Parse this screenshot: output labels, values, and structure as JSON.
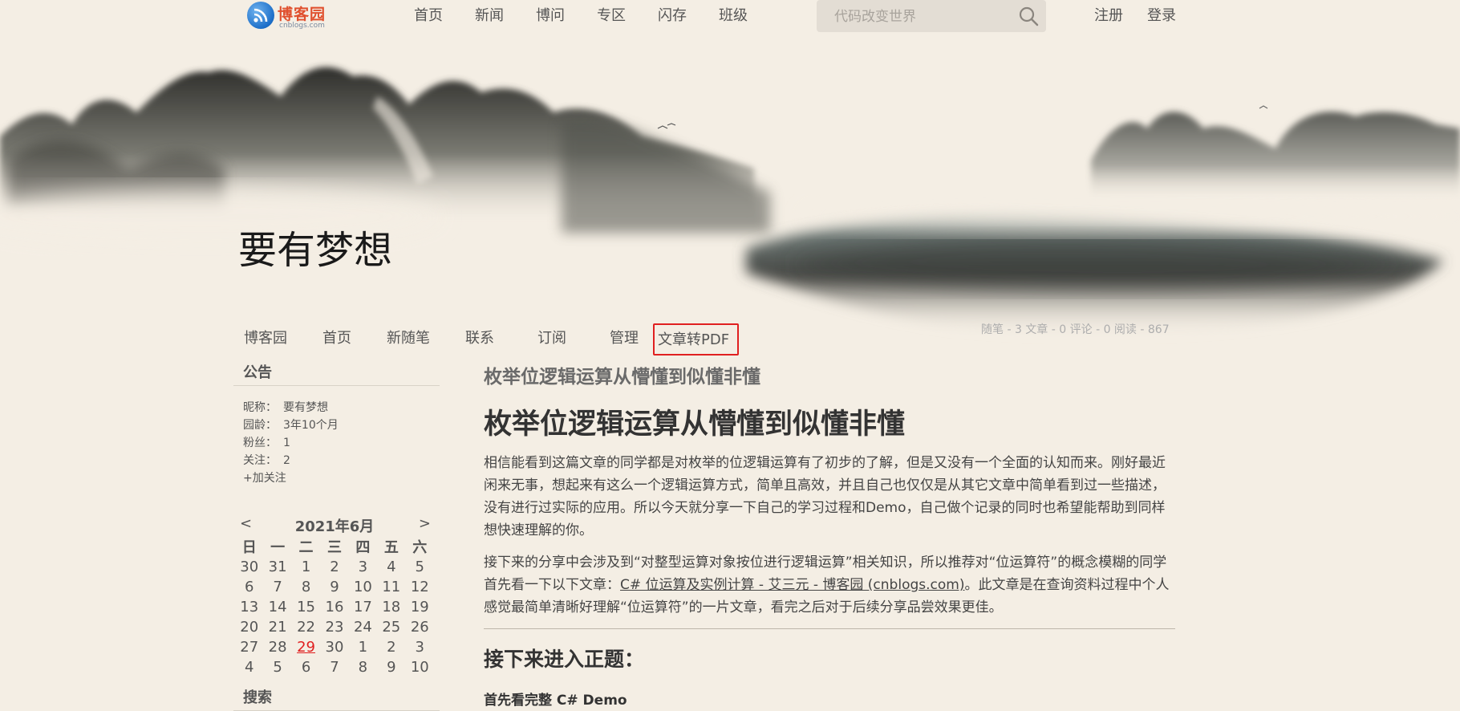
{
  "site": {
    "logo_text": "博客园",
    "logo_sub": "cnblogs.com",
    "nav": [
      "首页",
      "新闻",
      "博问",
      "专区",
      "闪存",
      "班级"
    ],
    "search_placeholder": "代码改变世界",
    "auth": [
      "注册",
      "登录"
    ]
  },
  "blog": {
    "title": "要有梦想",
    "nav": [
      "博客园",
      "首页",
      "新随笔",
      "联系",
      "订阅",
      "管理",
      "文章转PDF"
    ],
    "stats": "随笔 - 3  文章 - 0  评论 - 0  阅读 - 867"
  },
  "sidebar": {
    "notice_title": "公告",
    "profile": [
      {
        "k": "昵称：",
        "v": "要有梦想"
      },
      {
        "k": "园龄：",
        "v": "3年10个月"
      },
      {
        "k": "粉丝：",
        "v": "1"
      },
      {
        "k": "关注：",
        "v": "2"
      }
    ],
    "follow": "+加关注",
    "calendar": {
      "prev": "<",
      "month": "2021年6月",
      "next": ">",
      "weekdays": [
        "日",
        "一",
        "二",
        "三",
        "四",
        "五",
        "六"
      ],
      "weeks": [
        [
          "30",
          "31",
          "1",
          "2",
          "3",
          "4",
          "5"
        ],
        [
          "6",
          "7",
          "8",
          "9",
          "10",
          "11",
          "12"
        ],
        [
          "13",
          "14",
          "15",
          "16",
          "17",
          "18",
          "19"
        ],
        [
          "20",
          "21",
          "22",
          "23",
          "24",
          "25",
          "26"
        ],
        [
          "27",
          "28",
          "29",
          "30",
          "1",
          "2",
          "3"
        ],
        [
          "4",
          "5",
          "6",
          "7",
          "8",
          "9",
          "10"
        ]
      ],
      "today": "29"
    },
    "search_title": "搜索"
  },
  "article": {
    "title_small": "枚举位逻辑运算从懵懂到似懂非懂",
    "title_big": "枚举位逻辑运算从懵懂到似懂非懂",
    "para1": " 相信能看到这篇文章的同学都是对枚举的位逻辑运算有了初步的了解，但是又没有一个全面的认知而来。刚好最近闲来无事，想起来有这么一个逻辑运算方式，简单且高效，并且自己也仅仅是从其它文章中简单看到过一些描述，没有进行过实际的应用。所以今天就分享一下自己的学习过程和Demo，自己做个记录的同时也希望能帮助到同样想快速理解的你。",
    "para2_before": " 接下来的分享中会涉及到“对整型运算对象按位进行逻辑运算”相关知识，所以推荐对“位运算符”的概念模糊的同学首先看一下以下文章：",
    "para2_link": "C# 位运算及实例计算 - 艾三元 - 博客园 (cnblogs.com)",
    "para2_after": "。此文章是在查询资料过程中个人感觉最简单清晰好理解“位运算符”的一片文章，看完之后对于后续分享品尝效果更佳。",
    "heading": "接下来进入正题：",
    "subheading": "首先看完整 C# Demo"
  }
}
